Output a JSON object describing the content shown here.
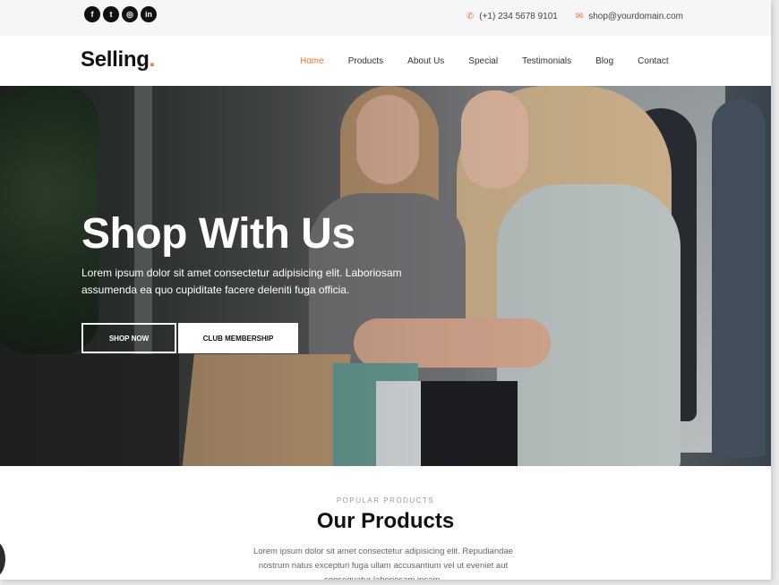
{
  "topbar": {
    "social": [
      {
        "icon": "facebook-icon",
        "glyph": "f"
      },
      {
        "icon": "twitter-icon",
        "glyph": "t"
      },
      {
        "icon": "instagram-icon",
        "glyph": "◎"
      },
      {
        "icon": "linkedin-icon",
        "glyph": "in"
      }
    ],
    "phone": "(+1) 234 5678 9101",
    "email": "shop@yourdomain.com"
  },
  "header": {
    "logo": "Selling",
    "logo_dot": ".",
    "nav": [
      "Home",
      "Products",
      "About Us",
      "Special",
      "Testimonials",
      "Blog",
      "Contact"
    ],
    "active": "Home"
  },
  "hero": {
    "title": "Shop With Us",
    "description": "Lorem ipsum dolor sit amet consectetur adipisicing elit. Laboriosam assumenda ea quo cupiditate facere deleniti fuga officia.",
    "btn_shop": "SHOP NOW",
    "btn_club": "CLUB MEMBERSHIP"
  },
  "products": {
    "eyebrow": "POPULAR PRODUCTS",
    "title": "Our Products",
    "description": "Lorem ipsum dolor sit amet consectetur adipisicing elit. Repudiandae nostrum natus excepturi fuga ullam accusantium vel ut eveniet aut consequatur laboriosam ipsam."
  },
  "colors": {
    "accent": "#f07338",
    "dark": "#111111"
  }
}
